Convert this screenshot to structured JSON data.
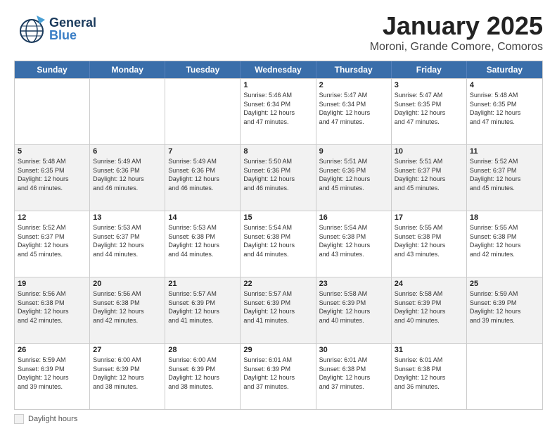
{
  "header": {
    "logo": {
      "line1": "General",
      "line2": "Blue"
    },
    "title": "January 2025",
    "subtitle": "Moroni, Grande Comore, Comoros"
  },
  "calendar": {
    "days_of_week": [
      "Sunday",
      "Monday",
      "Tuesday",
      "Wednesday",
      "Thursday",
      "Friday",
      "Saturday"
    ],
    "footer_label": "Daylight hours"
  },
  "weeks": [
    {
      "shaded": false,
      "cells": [
        {
          "day": "",
          "info": ""
        },
        {
          "day": "",
          "info": ""
        },
        {
          "day": "",
          "info": ""
        },
        {
          "day": "1",
          "info": "Sunrise: 5:46 AM\nSunset: 6:34 PM\nDaylight: 12 hours\nand 47 minutes."
        },
        {
          "day": "2",
          "info": "Sunrise: 5:47 AM\nSunset: 6:34 PM\nDaylight: 12 hours\nand 47 minutes."
        },
        {
          "day": "3",
          "info": "Sunrise: 5:47 AM\nSunset: 6:35 PM\nDaylight: 12 hours\nand 47 minutes."
        },
        {
          "day": "4",
          "info": "Sunrise: 5:48 AM\nSunset: 6:35 PM\nDaylight: 12 hours\nand 47 minutes."
        }
      ]
    },
    {
      "shaded": true,
      "cells": [
        {
          "day": "5",
          "info": "Sunrise: 5:48 AM\nSunset: 6:35 PM\nDaylight: 12 hours\nand 46 minutes."
        },
        {
          "day": "6",
          "info": "Sunrise: 5:49 AM\nSunset: 6:36 PM\nDaylight: 12 hours\nand 46 minutes."
        },
        {
          "day": "7",
          "info": "Sunrise: 5:49 AM\nSunset: 6:36 PM\nDaylight: 12 hours\nand 46 minutes."
        },
        {
          "day": "8",
          "info": "Sunrise: 5:50 AM\nSunset: 6:36 PM\nDaylight: 12 hours\nand 46 minutes."
        },
        {
          "day": "9",
          "info": "Sunrise: 5:51 AM\nSunset: 6:36 PM\nDaylight: 12 hours\nand 45 minutes."
        },
        {
          "day": "10",
          "info": "Sunrise: 5:51 AM\nSunset: 6:37 PM\nDaylight: 12 hours\nand 45 minutes."
        },
        {
          "day": "11",
          "info": "Sunrise: 5:52 AM\nSunset: 6:37 PM\nDaylight: 12 hours\nand 45 minutes."
        }
      ]
    },
    {
      "shaded": false,
      "cells": [
        {
          "day": "12",
          "info": "Sunrise: 5:52 AM\nSunset: 6:37 PM\nDaylight: 12 hours\nand 45 minutes."
        },
        {
          "day": "13",
          "info": "Sunrise: 5:53 AM\nSunset: 6:37 PM\nDaylight: 12 hours\nand 44 minutes."
        },
        {
          "day": "14",
          "info": "Sunrise: 5:53 AM\nSunset: 6:38 PM\nDaylight: 12 hours\nand 44 minutes."
        },
        {
          "day": "15",
          "info": "Sunrise: 5:54 AM\nSunset: 6:38 PM\nDaylight: 12 hours\nand 44 minutes."
        },
        {
          "day": "16",
          "info": "Sunrise: 5:54 AM\nSunset: 6:38 PM\nDaylight: 12 hours\nand 43 minutes."
        },
        {
          "day": "17",
          "info": "Sunrise: 5:55 AM\nSunset: 6:38 PM\nDaylight: 12 hours\nand 43 minutes."
        },
        {
          "day": "18",
          "info": "Sunrise: 5:55 AM\nSunset: 6:38 PM\nDaylight: 12 hours\nand 42 minutes."
        }
      ]
    },
    {
      "shaded": true,
      "cells": [
        {
          "day": "19",
          "info": "Sunrise: 5:56 AM\nSunset: 6:38 PM\nDaylight: 12 hours\nand 42 minutes."
        },
        {
          "day": "20",
          "info": "Sunrise: 5:56 AM\nSunset: 6:38 PM\nDaylight: 12 hours\nand 42 minutes."
        },
        {
          "day": "21",
          "info": "Sunrise: 5:57 AM\nSunset: 6:39 PM\nDaylight: 12 hours\nand 41 minutes."
        },
        {
          "day": "22",
          "info": "Sunrise: 5:57 AM\nSunset: 6:39 PM\nDaylight: 12 hours\nand 41 minutes."
        },
        {
          "day": "23",
          "info": "Sunrise: 5:58 AM\nSunset: 6:39 PM\nDaylight: 12 hours\nand 40 minutes."
        },
        {
          "day": "24",
          "info": "Sunrise: 5:58 AM\nSunset: 6:39 PM\nDaylight: 12 hours\nand 40 minutes."
        },
        {
          "day": "25",
          "info": "Sunrise: 5:59 AM\nSunset: 6:39 PM\nDaylight: 12 hours\nand 39 minutes."
        }
      ]
    },
    {
      "shaded": false,
      "cells": [
        {
          "day": "26",
          "info": "Sunrise: 5:59 AM\nSunset: 6:39 PM\nDaylight: 12 hours\nand 39 minutes."
        },
        {
          "day": "27",
          "info": "Sunrise: 6:00 AM\nSunset: 6:39 PM\nDaylight: 12 hours\nand 38 minutes."
        },
        {
          "day": "28",
          "info": "Sunrise: 6:00 AM\nSunset: 6:39 PM\nDaylight: 12 hours\nand 38 minutes."
        },
        {
          "day": "29",
          "info": "Sunrise: 6:01 AM\nSunset: 6:39 PM\nDaylight: 12 hours\nand 37 minutes."
        },
        {
          "day": "30",
          "info": "Sunrise: 6:01 AM\nSunset: 6:38 PM\nDaylight: 12 hours\nand 37 minutes."
        },
        {
          "day": "31",
          "info": "Sunrise: 6:01 AM\nSunset: 6:38 PM\nDaylight: 12 hours\nand 36 minutes."
        },
        {
          "day": "",
          "info": ""
        }
      ]
    }
  ]
}
